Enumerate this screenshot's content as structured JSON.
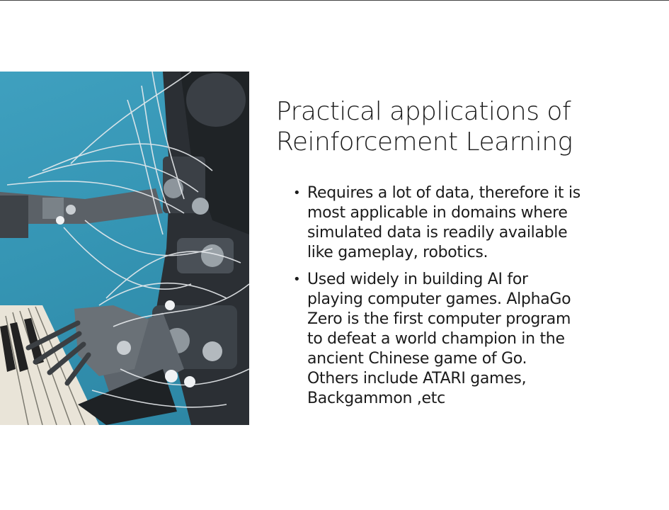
{
  "slide": {
    "title_lines": [
      "Practical applications of",
      "Reinforcement Learning"
    ],
    "bullets": [
      {
        "lines": [
          "Requires a lot of data, therefore it is",
          "most applicable in domains where",
          "simulated data is readily available",
          "like gameplay, robotics."
        ]
      },
      {
        "lines": [
          "Used widely in building AI for",
          "playing computer games. AlphaGo",
          "Zero is the first computer program",
          "to defeat a world champion in the",
          "ancient Chinese game of Go.",
          "Others include ATARI games,",
          "Backgammon ,etc"
        ]
      }
    ],
    "bullet_glyph": "•"
  },
  "colors": {
    "text": "#1b1b1b",
    "photo_background": "#3595b4"
  },
  "icons": {
    "photo": "robot-playing-piano-image"
  }
}
